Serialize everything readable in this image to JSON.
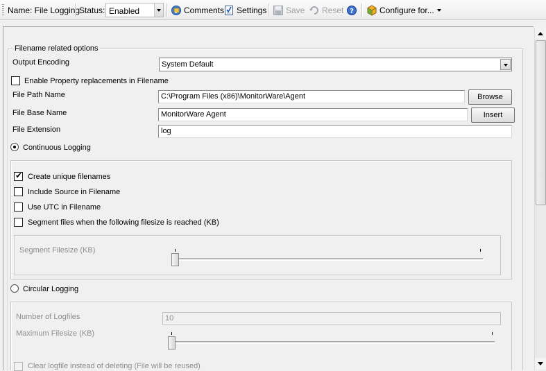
{
  "toolbar": {
    "name_label": "Name: File Logging",
    "status_label": "Status:",
    "status_value": "Enabled",
    "comments": "Comments",
    "settings": "Settings",
    "save": "Save",
    "reset": "Reset",
    "configure_for": "Configure for..."
  },
  "filename_group": {
    "legend": "Filename related options",
    "output_encoding_label": "Output Encoding",
    "output_encoding_value": "System Default",
    "enable_property_label": "Enable Property replacements in Filename",
    "enable_property_checked": false,
    "file_path_label": "File Path Name",
    "file_path_value": "C:\\Program Files (x86)\\MonitorWare\\Agent",
    "browse_button": "Browse",
    "file_base_label": "File Base Name",
    "file_base_value": "MonitorWare Agent",
    "insert_button": "Insert",
    "file_ext_label": "File Extension",
    "file_ext_value": "log"
  },
  "continuous": {
    "label": "Continuous Logging",
    "selected": true,
    "create_unique_label": "Create unique filenames",
    "create_unique_checked": true,
    "include_source_label": "Include Source in Filename",
    "include_source_checked": false,
    "use_utc_label": "Use UTC in Filename",
    "use_utc_checked": false,
    "segment_label": "Segment files when the following filesize is reached (KB)",
    "segment_checked": false,
    "segment_filesize_label": "Segment Filesize (KB)",
    "segment_slider_fraction": 0.0
  },
  "circular": {
    "label": "Circular Logging",
    "selected": false,
    "num_logfiles_label": "Number of Logfiles",
    "num_logfiles_value": "10",
    "max_filesize_label": "Maximum Filesize (KB)",
    "max_filesize_fraction": 0.0,
    "clear_logfile_label": "Clear logfile instead of deleting (File will be reused)"
  },
  "icons": {
    "comments": "comments-icon",
    "settings": "settings-icon",
    "save": "save-icon",
    "reset": "reset-icon",
    "help": "help-icon",
    "configure": "configure-icon"
  }
}
